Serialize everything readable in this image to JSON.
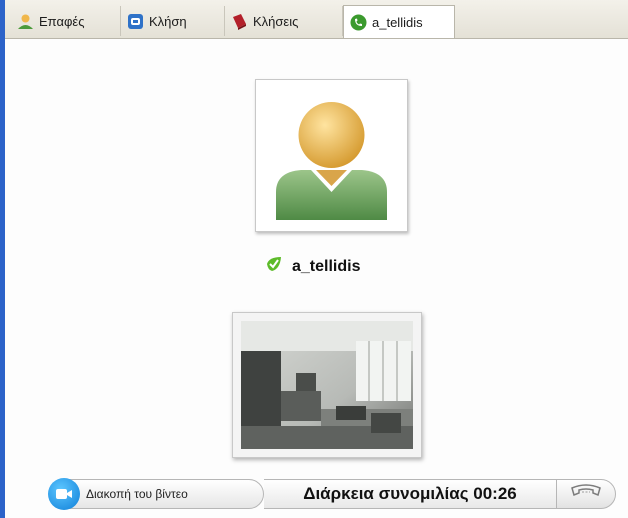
{
  "tabs": [
    {
      "label": "Επαφές",
      "icon": "contacts-icon"
    },
    {
      "label": "Κλήση",
      "icon": "phone-call-icon"
    },
    {
      "label": "Κλήσεις",
      "icon": "call-history-book-icon"
    },
    {
      "label": "a_tellidis",
      "icon": "active-call-icon",
      "active": true
    }
  ],
  "contact": {
    "name": "a_tellidis",
    "status_icon": "online-status-icon"
  },
  "controls": {
    "stop_video_label": "Διακοπή του βίντεο",
    "duration_label": "Διάρκεια συνομιλίας 00:26",
    "hangup_icon": "hangup-icon"
  },
  "colors": {
    "window_border": "#2c63c9",
    "camera_button": "#0f7fd8",
    "status_green": "#5dbb2a"
  }
}
